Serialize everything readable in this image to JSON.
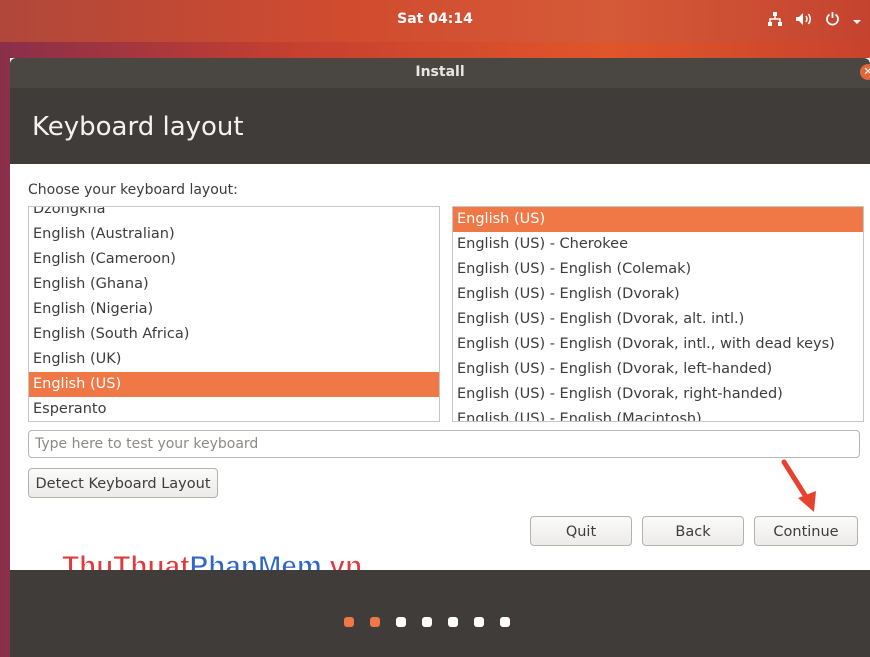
{
  "top_panel": {
    "clock": "Sat 04:14"
  },
  "window": {
    "title": "Install",
    "heading": "Keyboard layout"
  },
  "prompt": "Choose your keyboard layout:",
  "layouts": {
    "items": [
      "Dzongkha",
      "English (Australian)",
      "English (Cameroon)",
      "English (Ghana)",
      "English (Nigeria)",
      "English (South Africa)",
      "English (UK)",
      "English (US)",
      "Esperanto"
    ],
    "selected": "English (US)"
  },
  "variants": {
    "items": [
      "English (US)",
      "English (US) - Cherokee",
      "English (US) - English (Colemak)",
      "English (US) - English (Dvorak)",
      "English (US) - English (Dvorak, alt. intl.)",
      "English (US) - English (Dvorak, intl., with dead keys)",
      "English (US) - English (Dvorak, left-handed)",
      "English (US) - English (Dvorak, right-handed)",
      "English (US) - English (Macintosh)"
    ],
    "selected": "English (US)"
  },
  "test_input": {
    "placeholder": "Type here to test your keyboard",
    "value": ""
  },
  "buttons": {
    "detect": "Detect Keyboard Layout",
    "quit": "Quit",
    "back": "Back",
    "continue": "Continue"
  },
  "watermark": {
    "part1": "ThuThuat",
    "part2": "PhanMem",
    "part3": ".vn"
  },
  "progress": {
    "total_steps": 7,
    "current_step": 2
  },
  "colors": {
    "accent": "#f07746",
    "dot_active": "#f07746",
    "dot_inactive": "#ffffff",
    "arrow": "#e8412f"
  }
}
